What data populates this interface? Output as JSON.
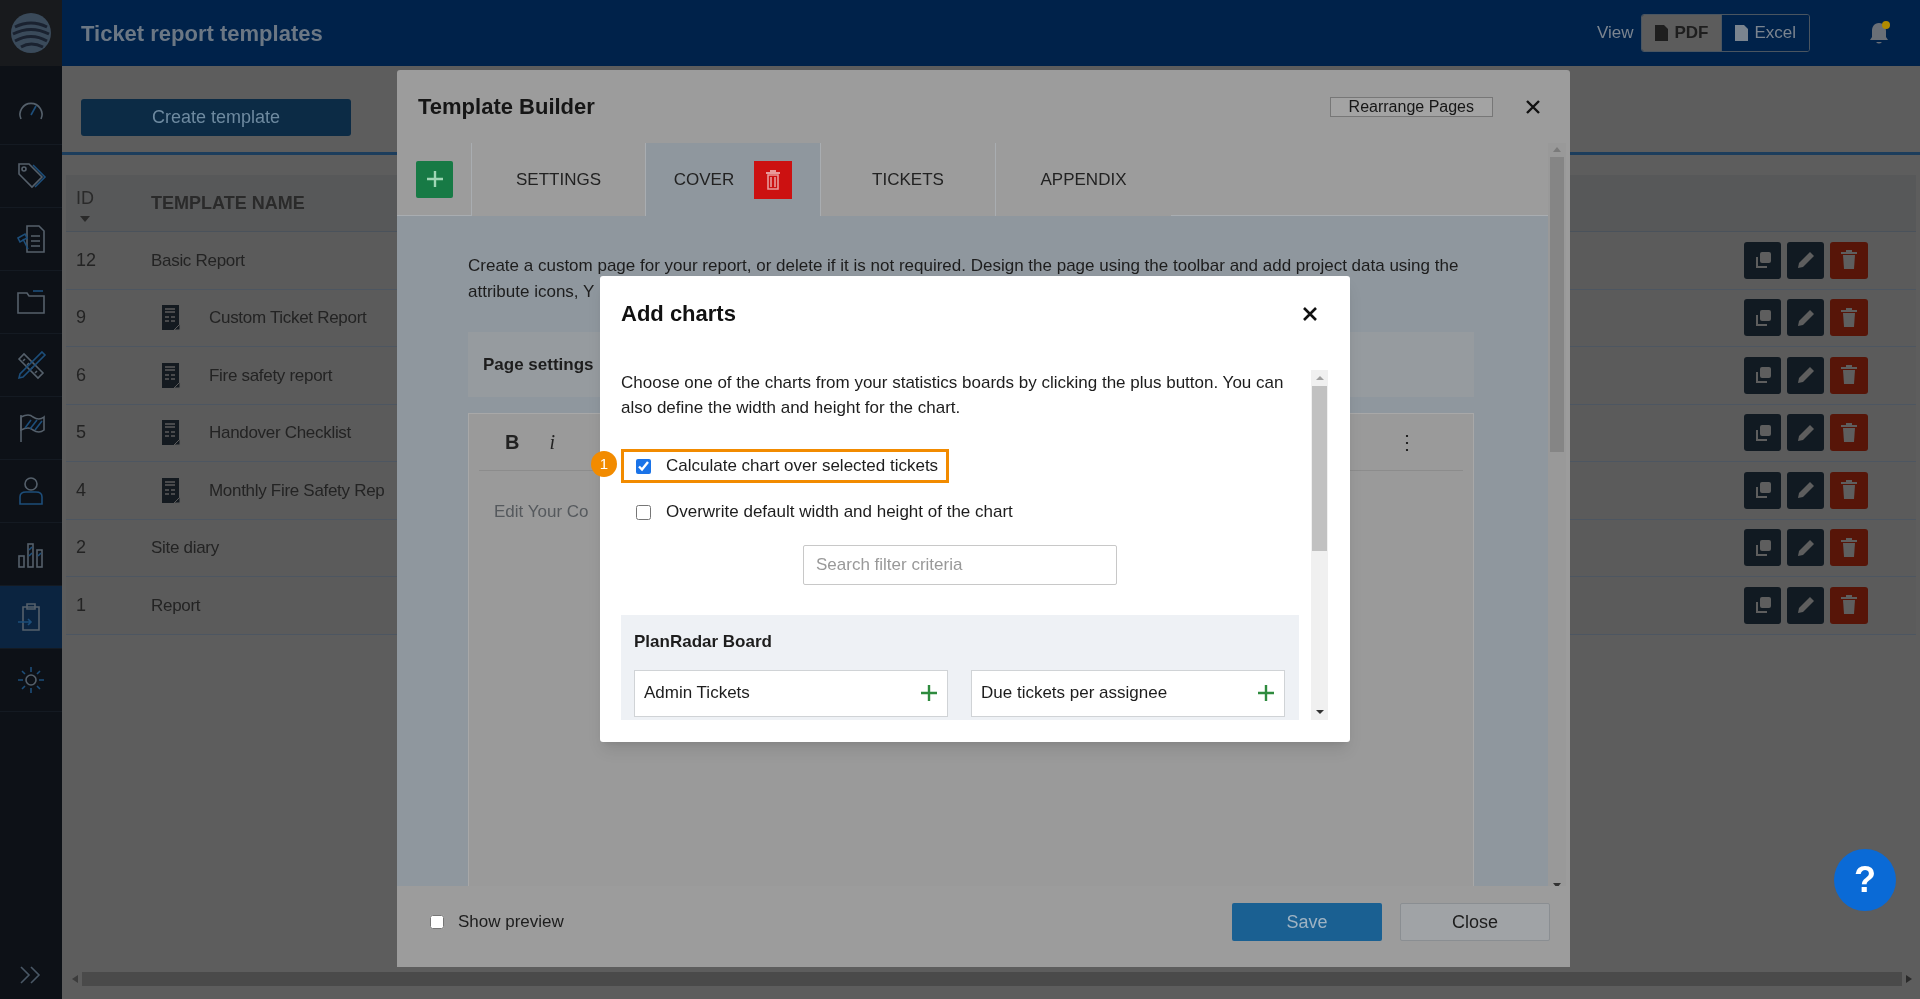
{
  "app": {
    "title": "Ticket report templates",
    "view_label": "View",
    "export_buttons": [
      {
        "label": "PDF",
        "selected": true
      },
      {
        "label": "Excel",
        "selected": false
      }
    ]
  },
  "sidebar": {
    "items": [
      {
        "selected": false
      },
      {
        "selected": false
      },
      {
        "selected": false
      },
      {
        "selected": false
      },
      {
        "selected": false
      },
      {
        "selected": false
      },
      {
        "selected": false
      },
      {
        "selected": false
      },
      {
        "selected": true
      },
      {
        "selected": false
      }
    ]
  },
  "create_button": "Create template",
  "table": {
    "columns": [
      "ID",
      "TEMPLATE NAME"
    ],
    "rows": [
      {
        "id": "12",
        "name": "Basic Report",
        "kind": "plain"
      },
      {
        "id": "9",
        "name": "Custom Ticket Report",
        "kind": "custom"
      },
      {
        "id": "6",
        "name": "Fire safety report",
        "kind": "custom"
      },
      {
        "id": "5",
        "name": "Handover Checklist",
        "kind": "custom"
      },
      {
        "id": "4",
        "name": "Monthly Fire Safety Rep",
        "kind": "custom"
      },
      {
        "id": "2",
        "name": "Site diary",
        "kind": "plain"
      },
      {
        "id": "1",
        "name": "Report",
        "kind": "plain"
      }
    ]
  },
  "template_builder": {
    "title": "Template Builder",
    "rearrange_button": "Rearrange Pages",
    "tabs": [
      {
        "label": "SETTINGS",
        "selected": false,
        "deletable": false
      },
      {
        "label": "COVER",
        "selected": true,
        "deletable": true
      },
      {
        "label": "TICKETS",
        "selected": false,
        "deletable": false
      },
      {
        "label": "APPENDIX",
        "selected": false,
        "deletable": false
      }
    ],
    "intro_lines": [
      "Create a custom page for your report, or delete if it is not required. Design the page using the toolbar and add project data using the",
      "attribute icons, Y"
    ],
    "page_settings": "Page settings",
    "editor": {
      "tools": [
        "B",
        "i"
      ],
      "more": "⋮",
      "placeholder": "Edit Your Co"
    },
    "show_preview": {
      "label": "Show preview",
      "checked": false
    },
    "save_button": "Save",
    "close_button": "Close"
  },
  "add_charts": {
    "title": "Add charts",
    "description": "Choose one of the charts from your statistics boards by clicking the plus button. You can also define the width and height for the chart.",
    "step_badge": "1",
    "options": [
      {
        "label": "Calculate chart over selected tickets",
        "checked": true,
        "highlighted": true
      },
      {
        "label": "Overwrite default width and height of the chart",
        "checked": false,
        "highlighted": false
      }
    ],
    "search": {
      "placeholder": "Search filter criteria"
    },
    "boards": [
      {
        "name": "PlanRadar Board",
        "charts": [
          "Admin Tickets",
          "Due tickets per assignee"
        ]
      }
    ]
  },
  "help_button": "?"
}
